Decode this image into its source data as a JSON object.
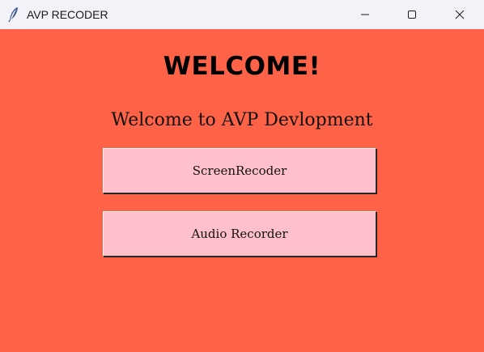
{
  "colors": {
    "background": "#ff6347",
    "button_bg": "#ffc0cb",
    "titlebar_bg": "#f3f2f8"
  },
  "window": {
    "title": "AVP RECODER",
    "icon": "feather-icon",
    "controls": {
      "minimize": "minimize-icon",
      "maximize": "maximize-icon",
      "close": "close-icon"
    }
  },
  "main": {
    "heading": "WELCOME!",
    "subtitle": "Welcome to AVP Devlopment",
    "buttons": {
      "screen_recorder": "ScreenRecoder",
      "audio_recorder": "Audio Recorder"
    }
  }
}
